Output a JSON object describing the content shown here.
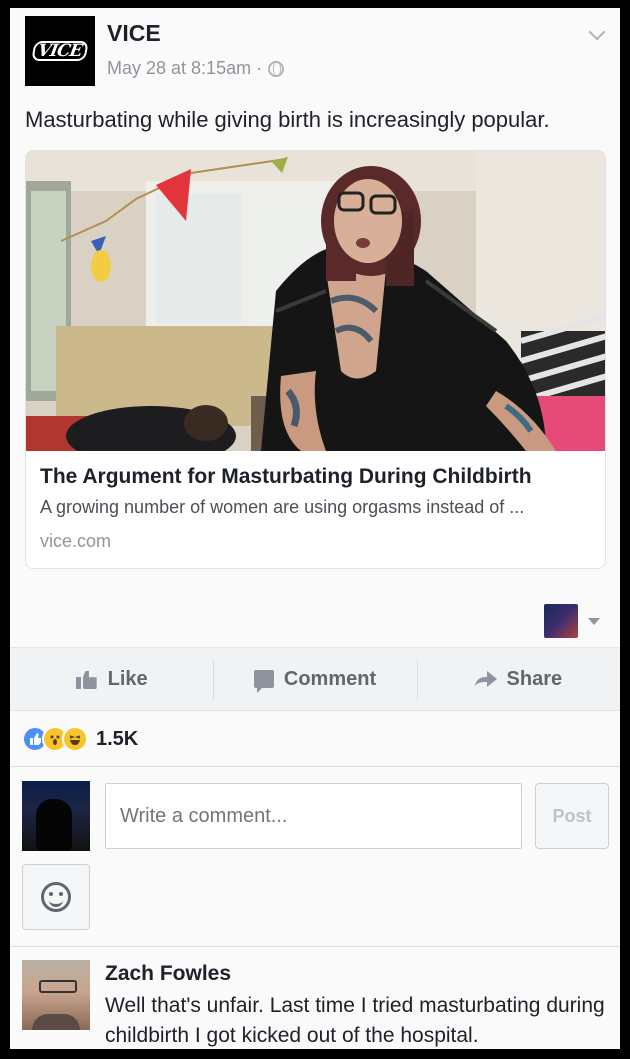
{
  "post": {
    "page_name": "VICE",
    "logo_text": "VICE",
    "timestamp": "May 28 at 8:15am ·",
    "text": "Masturbating while giving birth is increasingly popular."
  },
  "link_card": {
    "title": "The Argument for Masturbating During Childbirth",
    "description": "A growing number of women are using orgasms instead of ...",
    "domain": "vice.com"
  },
  "actions": {
    "like": "Like",
    "comment": "Comment",
    "share": "Share"
  },
  "reactions": {
    "types": [
      "like",
      "wow",
      "haha"
    ],
    "count": "1.5K"
  },
  "composer": {
    "placeholder": "Write a comment...",
    "post_label": "Post"
  },
  "comment": {
    "author": "Zach Fowles",
    "text": "Well that's unfair. Last time I tried masturbating during childbirth I got kicked out of the hospital."
  },
  "colors": {
    "accent_blue": "#4a90f6",
    "reaction_yellow": "#f7c42c",
    "secondary_text": "#90949c"
  }
}
